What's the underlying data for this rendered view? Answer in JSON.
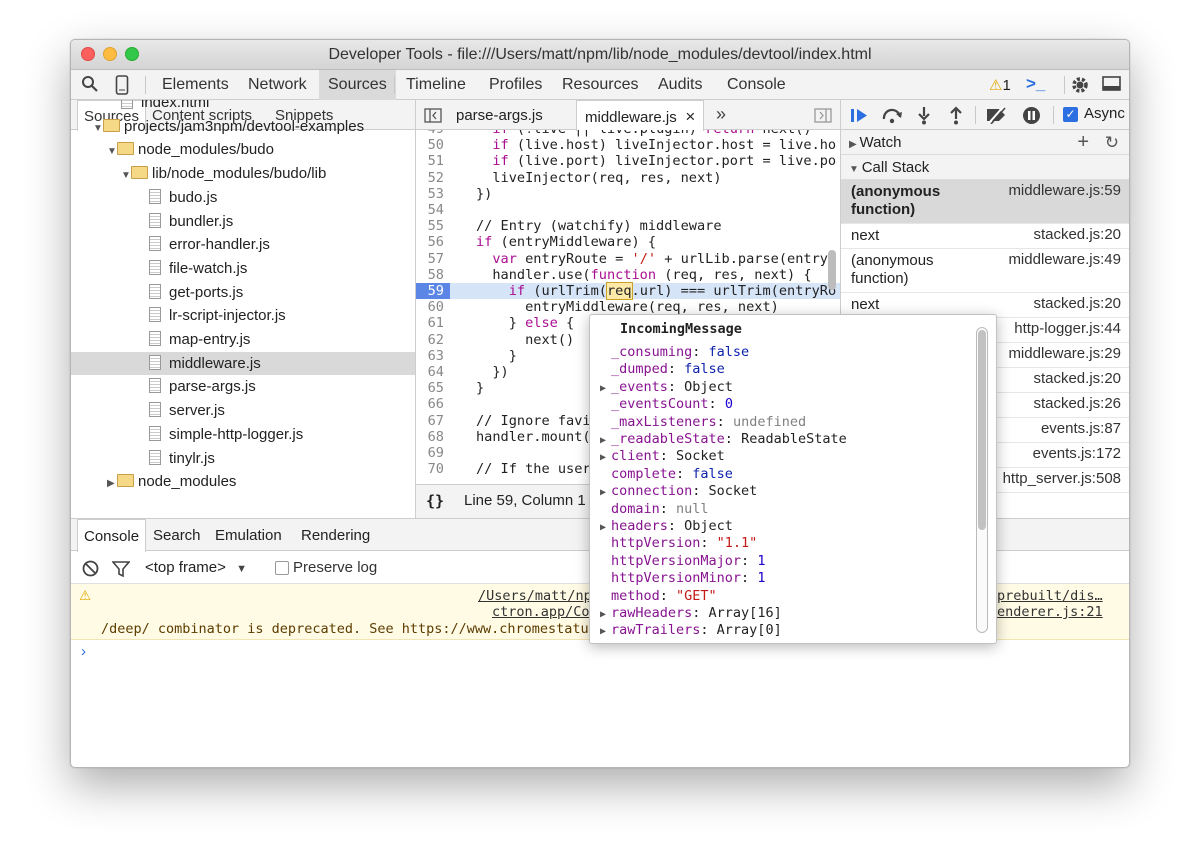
{
  "window": {
    "title": "Developer Tools - file:///Users/matt/npm/lib/node_modules/devtool/index.html"
  },
  "toolbar": {
    "tabs": [
      "Elements",
      "Network",
      "Sources",
      "Timeline",
      "Profiles",
      "Resources",
      "Audits",
      "Console"
    ],
    "active": "Sources",
    "warnings": "1",
    "icons": [
      "search-icon",
      "device-icon",
      "warning-icon",
      "console-prompt-icon",
      "gear-icon",
      "dock-icon"
    ]
  },
  "navigator": {
    "tabs": [
      "Sources",
      "Content scripts",
      "Snippets"
    ],
    "active": "Sources",
    "tree": [
      {
        "label": "index.html",
        "type": "file",
        "depth": 2
      },
      {
        "label": "projects/jam3npm/devtool-examples",
        "type": "folder",
        "depth": 1,
        "open": true
      },
      {
        "label": "node_modules/budo",
        "type": "folder",
        "depth": 2,
        "open": true
      },
      {
        "label": "lib/node_modules/budo/lib",
        "type": "folder",
        "depth": 3,
        "open": true
      },
      {
        "label": "budo.js",
        "type": "file",
        "depth": 4
      },
      {
        "label": "bundler.js",
        "type": "file",
        "depth": 4
      },
      {
        "label": "error-handler.js",
        "type": "file",
        "depth": 4
      },
      {
        "label": "file-watch.js",
        "type": "file",
        "depth": 4
      },
      {
        "label": "get-ports.js",
        "type": "file",
        "depth": 4
      },
      {
        "label": "lr-script-injector.js",
        "type": "file",
        "depth": 4
      },
      {
        "label": "map-entry.js",
        "type": "file",
        "depth": 4
      },
      {
        "label": "middleware.js",
        "type": "file",
        "depth": 4,
        "selected": true
      },
      {
        "label": "parse-args.js",
        "type": "file",
        "depth": 4
      },
      {
        "label": "server.js",
        "type": "file",
        "depth": 4
      },
      {
        "label": "simple-http-logger.js",
        "type": "file",
        "depth": 4
      },
      {
        "label": "tinylr.js",
        "type": "file",
        "depth": 4
      },
      {
        "label": "node_modules",
        "type": "folder",
        "depth": 2,
        "open": false
      }
    ]
  },
  "editor": {
    "tabs": [
      "parse-args.js",
      "middleware.js"
    ],
    "active": "middleware.js",
    "more": "»",
    "lines": [
      {
        "n": "49",
        "t": "  if (!live || live.plugin) return next()"
      },
      {
        "n": "50",
        "t": "  if (live.host) liveInjector.host = live.ho"
      },
      {
        "n": "51",
        "t": "  if (live.port) liveInjector.port = live.po"
      },
      {
        "n": "52",
        "t": "  liveInjector(req, res, next)"
      },
      {
        "n": "53",
        "t": "})"
      },
      {
        "n": "54",
        "t": ""
      },
      {
        "n": "55",
        "t": "// Entry (watchify) middleware",
        "c": true
      },
      {
        "n": "56",
        "t": "if (entryMiddleware) {"
      },
      {
        "n": "57",
        "t": "  var entryRoute = '/' + urlLib.parse(entryS"
      },
      {
        "n": "58",
        "t": "  handler.use(function (req, res, next) {"
      },
      {
        "n": "59",
        "t": "    if (urlTrim(req.url) === urlTrim(entryRo",
        "hl": true
      },
      {
        "n": "60",
        "t": "      entryMiddleware(req, res, next)"
      },
      {
        "n": "61",
        "t": "    } else {"
      },
      {
        "n": "62",
        "t": "      next()"
      },
      {
        "n": "63",
        "t": "    }"
      },
      {
        "n": "64",
        "t": "  })"
      },
      {
        "n": "65",
        "t": "}"
      },
      {
        "n": "66",
        "t": ""
      },
      {
        "n": "67",
        "t": "// Ignore favi",
        "c": true
      },
      {
        "n": "68",
        "t": "handler.mount("
      },
      {
        "n": "69",
        "t": ""
      },
      {
        "n": "70",
        "t": "// If the user",
        "c": true
      }
    ],
    "status": "Line 59, Column 1",
    "pretty": "{}"
  },
  "debugger": {
    "async_label": "Async",
    "watch": "Watch",
    "callstack": "Call Stack",
    "frames": [
      {
        "fn": "(anonymous function)",
        "loc": "middleware.js:59",
        "selected": true
      },
      {
        "fn": "next",
        "loc": "stacked.js:20"
      },
      {
        "fn": "(anonymous function)",
        "loc": "middleware.js:49"
      },
      {
        "fn": "next",
        "loc": "stacked.js:20"
      },
      {
        "fn": "",
        "loc": "http-logger.js:44"
      },
      {
        "fn": "",
        "loc": "middleware.js:29"
      },
      {
        "fn": "",
        "loc": "stacked.js:20"
      },
      {
        "fn": "",
        "loc": "stacked.js:26"
      },
      {
        "fn": "",
        "loc": "events.js:87"
      },
      {
        "fn": "",
        "loc": "events.js:172"
      },
      {
        "fn": "",
        "loc": "http_server.js:508"
      }
    ]
  },
  "drawer": {
    "tabs": [
      "Console",
      "Search",
      "Emulation",
      "Rendering"
    ],
    "active": "Console",
    "frame": "<top frame>",
    "preserve_log": "Preserve log",
    "warning": {
      "link1": "/Users/matt/np",
      "link2": "ctron.app/Co",
      "message": "/deep/ combinator is deprecated. See https://www.chromestatu",
      "right1": "prebuilt/dis…",
      "right2": "enderer.js:21"
    },
    "prompt": "›"
  },
  "popover": {
    "title": "IncomingMessage",
    "props": [
      {
        "k": "_consuming",
        "v": "false",
        "t": "b"
      },
      {
        "k": "_dumped",
        "v": "false",
        "t": "b"
      },
      {
        "k": "_events",
        "v": "Object",
        "t": "o",
        "x": true
      },
      {
        "k": "_eventsCount",
        "v": "0",
        "t": "n"
      },
      {
        "k": "_maxListeners",
        "v": "undefined",
        "t": "u"
      },
      {
        "k": "_readableState",
        "v": "ReadableState",
        "t": "o",
        "x": true
      },
      {
        "k": "client",
        "v": "Socket",
        "t": "o",
        "x": true
      },
      {
        "k": "complete",
        "v": "false",
        "t": "b"
      },
      {
        "k": "connection",
        "v": "Socket",
        "t": "o",
        "x": true
      },
      {
        "k": "domain",
        "v": "null",
        "t": "u"
      },
      {
        "k": "headers",
        "v": "Object",
        "t": "o",
        "x": true
      },
      {
        "k": "httpVersion",
        "v": "\"1.1\"",
        "t": "s"
      },
      {
        "k": "httpVersionMajor",
        "v": "1",
        "t": "n"
      },
      {
        "k": "httpVersionMinor",
        "v": "1",
        "t": "n"
      },
      {
        "k": "method",
        "v": "\"GET\"",
        "t": "s"
      },
      {
        "k": "rawHeaders",
        "v": "Array[16]",
        "t": "o",
        "x": true
      },
      {
        "k": "rawTrailers",
        "v": "Array[0]",
        "t": "o",
        "x": true
      }
    ]
  }
}
